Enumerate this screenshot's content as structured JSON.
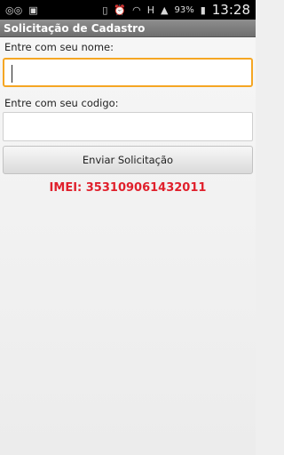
{
  "status_bar": {
    "battery": "93%",
    "time": "13:28",
    "icons": [
      "voicemail-icon",
      "image-icon",
      "vibrate-icon",
      "alarm-icon",
      "wifi-icon",
      "data-h-icon",
      "signal-icon",
      "battery-icon"
    ]
  },
  "app": {
    "title": "Solicitação de Cadastro"
  },
  "form": {
    "name_label": "Entre com seu nome:",
    "name_value": "",
    "code_label": "Entre com seu codigo:",
    "code_value": "",
    "submit_label": "Enviar Solicitação"
  },
  "imei_text": "IMEI: 353109061432011",
  "colors": {
    "focus": "#f5a623",
    "imei": "#e0202c"
  }
}
